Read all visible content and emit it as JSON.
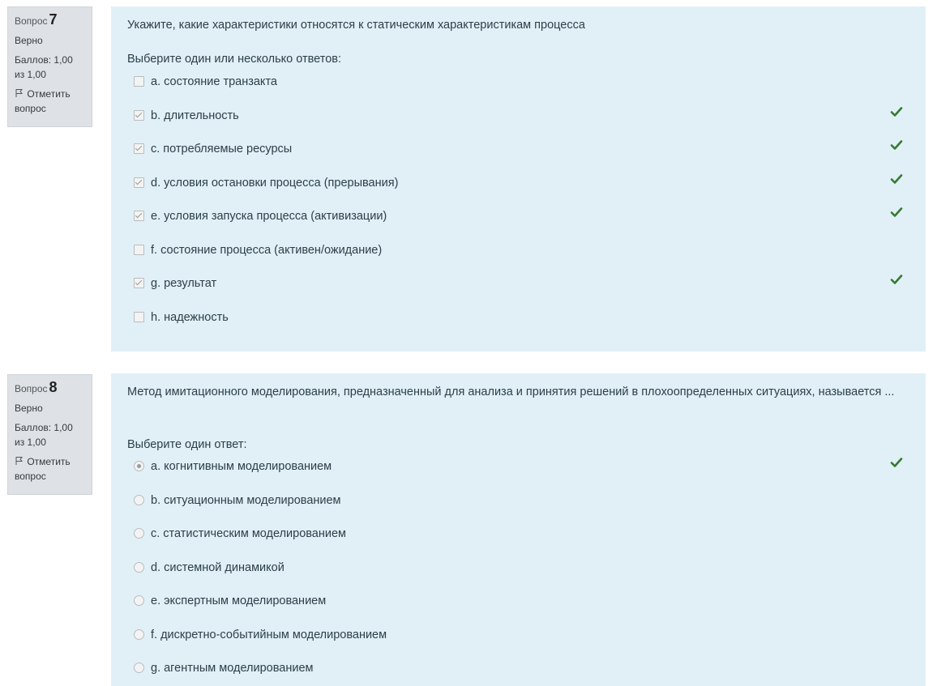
{
  "questions": [
    {
      "prefix": "Вопрос",
      "number": "7",
      "state": "Верно",
      "grade": "Баллов: 1,00 из 1,00",
      "flag_label": "Отметить вопрос",
      "text": "Укажите, какие характеристики относятся к статическим характеристикам процесса",
      "prompt": "Выберите один или несколько ответов:",
      "options": [
        {
          "label": "a. состояние транзакта",
          "checked": false,
          "correct": false
        },
        {
          "label": "b. длительность",
          "checked": true,
          "correct": true
        },
        {
          "label": "c. потребляемые ресурсы",
          "checked": true,
          "correct": true
        },
        {
          "label": "d. условия остановки процесса (прерывания)",
          "checked": true,
          "correct": true
        },
        {
          "label": "e. условия запуска процесса (активизации)",
          "checked": true,
          "correct": true
        },
        {
          "label": "f. состояние процесса (активен/ожидание)",
          "checked": false,
          "correct": false
        },
        {
          "label": "g. результат",
          "checked": true,
          "correct": true
        },
        {
          "label": "h. надежность",
          "checked": false,
          "correct": false
        }
      ]
    },
    {
      "prefix": "Вопрос",
      "number": "8",
      "state": "Верно",
      "grade": "Баллов: 1,00 из 1,00",
      "flag_label": "Отметить вопрос",
      "text": "Метод имитационного моделирования, предназначенный для анализа и принятия решений в плохоопределенных ситуациях, называется ...",
      "prompt": "Выберите один ответ:",
      "options": [
        {
          "label": "a. когнитивным моделированием",
          "checked": true,
          "correct": true
        },
        {
          "label": "b. ситуационным моделированием",
          "checked": false,
          "correct": false
        },
        {
          "label": "c. статистическим моделированием",
          "checked": false,
          "correct": false
        },
        {
          "label": "d. системной динамикой",
          "checked": false,
          "correct": false
        },
        {
          "label": "e. экспертным моделированием",
          "checked": false,
          "correct": false
        },
        {
          "label": "f. дискретно-событийным моделированием",
          "checked": false,
          "correct": false
        },
        {
          "label": "g. агентным моделированием",
          "checked": false,
          "correct": false
        }
      ]
    }
  ],
  "colors": {
    "panel": "#e0f0f6",
    "info": "#dee2e6",
    "correct": "#357a32"
  },
  "icons": {
    "flag": "flag-icon",
    "correct": "check-icon"
  }
}
